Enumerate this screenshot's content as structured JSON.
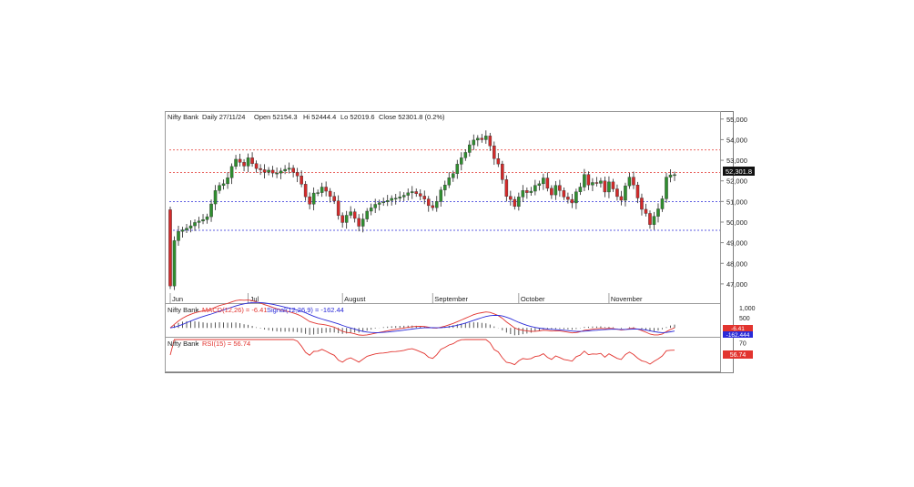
{
  "chart_data": {
    "type": "candlestick",
    "symbol": "Nifty Bank",
    "header": {
      "symbol": "Nifty Bank",
      "period": "Daily 27/11/24",
      "open": "Open 52154.3",
      "high": "Hi 52444.4",
      "low": "Lo 52019.6",
      "close": "Close 52301.8 (0.2%)"
    },
    "last_close_label": "52,301.8",
    "y_ticks": [
      {
        "value": 55000,
        "label": "55,000"
      },
      {
        "value": 54000,
        "label": "54,000"
      },
      {
        "value": 53000,
        "label": "53,000"
      },
      {
        "value": 52000,
        "label": "52,000"
      },
      {
        "value": 51000,
        "label": "51,000"
      },
      {
        "value": 50000,
        "label": "50,000"
      },
      {
        "value": 49000,
        "label": "49,000"
      },
      {
        "value": 48000,
        "label": "48,000"
      },
      {
        "value": 47000,
        "label": "47,000"
      }
    ],
    "ylim": [
      46200,
      55300
    ],
    "month_labels": [
      {
        "index": 0,
        "label": "Jun"
      },
      {
        "index": 19,
        "label": "Jul"
      },
      {
        "index": 42,
        "label": "August"
      },
      {
        "index": 64,
        "label": "September"
      },
      {
        "index": 85,
        "label": "October"
      },
      {
        "index": 107,
        "label": "November"
      }
    ],
    "levels": [
      {
        "value": 53500,
        "color": "#e2342f",
        "label": "resistance"
      },
      {
        "value": 52400,
        "color": "#e2342f",
        "label": "resistance"
      },
      {
        "value": 51000,
        "color": "#2a2ad8",
        "label": "support"
      },
      {
        "value": 49600,
        "color": "#2a2ad8",
        "label": "support"
      }
    ],
    "closes": [
      46900,
      49100,
      49550,
      49620,
      49700,
      49820,
      49980,
      50050,
      50120,
      50260,
      50880,
      51530,
      51780,
      51860,
      52150,
      52700,
      53050,
      52900,
      52720,
      53120,
      52840,
      52600,
      52540,
      52420,
      52520,
      52380,
      52380,
      52480,
      52560,
      52620,
      52420,
      52240,
      51840,
      51230,
      50870,
      51410,
      51430,
      51700,
      51500,
      51250,
      51030,
      50320,
      49980,
      50330,
      50500,
      50180,
      49800,
      50150,
      50530,
      50690,
      50860,
      50940,
      50980,
      51050,
      51150,
      51160,
      51220,
      51300,
      51420,
      51480,
      51380,
      51260,
      51120,
      50800,
      50700,
      51000,
      51560,
      51800,
      52150,
      52350,
      52810,
      53120,
      53380,
      53750,
      53980,
      54070,
      54000,
      54180,
      53700,
      53080,
      52820,
      52060,
      51250,
      51100,
      50760,
      51220,
      51530,
      51430,
      51500,
      51780,
      51860,
      52140,
      51640,
      51320,
      51780,
      51530,
      51220,
      51100,
      50930,
      51470,
      51700,
      52310,
      51800,
      51920,
      51880,
      52000,
      51460,
      51950,
      51610,
      51240,
      51060,
      51760,
      52180,
      51800,
      51170,
      50620,
      50420,
      49880,
      50280,
      50640,
      51130,
      52180,
      52290,
      52301.8
    ],
    "macd": {
      "label": "MACD(12,26) = -6.41",
      "signal_label": "Signal(12,26,9) = -162.44",
      "value_label": "-6.41",
      "signal_value_label": "-162.444",
      "ticks": [
        {
          "value": 1000,
          "label": "1,000"
        },
        {
          "value": 500,
          "label": "500"
        }
      ],
      "ylim": [
        -400,
        1100
      ],
      "macd_color": "#e2342f",
      "signal_color": "#2a2ad8"
    },
    "rsi": {
      "label": "RSI(15) = 56.74",
      "value_label": "56.74",
      "ticks": [
        {
          "value": 70,
          "label": "70"
        }
      ],
      "ylim": [
        25,
        75
      ],
      "color": "#e2342f"
    },
    "colors": {
      "up": "#2f8f2f",
      "down": "#d42a2a",
      "wick": "#222222"
    }
  }
}
